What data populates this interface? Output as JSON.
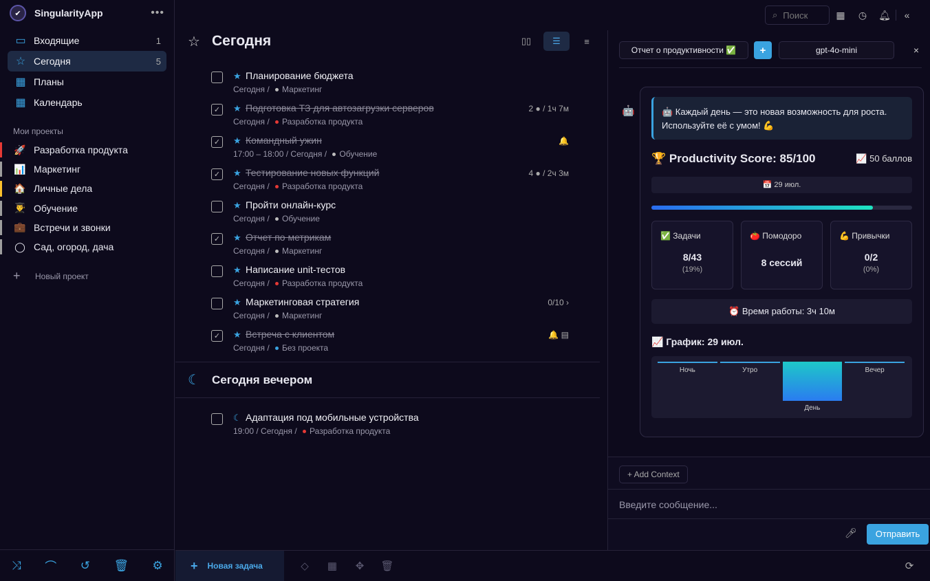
{
  "app": {
    "name": "SingularityApp"
  },
  "nav": [
    {
      "label": "Входящие",
      "count": "1",
      "icon": "inbox-icon",
      "glyph": "▭"
    },
    {
      "label": "Сегодня",
      "count": "5",
      "icon": "star-icon",
      "glyph": "☆"
    },
    {
      "label": "Планы",
      "count": "",
      "icon": "calendar-29-icon",
      "glyph": "▦"
    },
    {
      "label": "Календарь",
      "count": "",
      "icon": "calendar-icon",
      "glyph": "▦"
    }
  ],
  "projects_title": "Мои проекты",
  "projects": [
    {
      "label": "Разработка продукта",
      "glyph": "🚀",
      "color": "#e53935"
    },
    {
      "label": "Маркетинг",
      "glyph": "📊",
      "color": "#9e9e9e"
    },
    {
      "label": "Личные дела",
      "glyph": "🏠",
      "color": "#fbc02d"
    },
    {
      "label": "Обучение",
      "glyph": "👨‍🎓",
      "color": "#9e9e9e"
    },
    {
      "label": "Встречи и звонки",
      "glyph": "💼",
      "color": "#9e9e9e"
    },
    {
      "label": "Сад, огород, дача",
      "glyph": "◯",
      "color": "#9e9e9e"
    }
  ],
  "new_project": "Новый проект",
  "search_placeholder": "Поиск",
  "main_title": "Сегодня",
  "tasks": [
    {
      "title": "Планирование бюджета",
      "done": false,
      "meta": "Сегодня",
      "project": "Маркетинг",
      "dot": "#bdbdbd",
      "right": ""
    },
    {
      "title": "Подготовка ТЗ для автозагрузки серверов",
      "done": true,
      "meta": "Сегодня",
      "project": "Разработка продукта",
      "dot": "#e53935",
      "right": "2 ● / 1ч 7м"
    },
    {
      "title": "Командный ужин",
      "done": true,
      "meta": "17:00 – 18:00 / Сегодня",
      "project": "Обучение",
      "dot": "#bdbdbd",
      "right": "🔔"
    },
    {
      "title": "Тестирование новых функций",
      "done": true,
      "meta": "Сегодня",
      "project": "Разработка продукта",
      "dot": "#e53935",
      "right": "4 ● / 2ч 3м"
    },
    {
      "title": "Пройти онлайн-курс",
      "done": false,
      "meta": "Сегодня",
      "project": "Обучение",
      "dot": "#bdbdbd",
      "right": ""
    },
    {
      "title": "Отчет по метрикам",
      "done": true,
      "meta": "Сегодня",
      "project": "Маркетинг",
      "dot": "#bdbdbd",
      "right": ""
    },
    {
      "title": "Написание unit-тестов",
      "done": false,
      "meta": "Сегодня",
      "project": "Разработка продукта",
      "dot": "#e53935",
      "right": ""
    },
    {
      "title": "Маркетинговая стратегия",
      "done": false,
      "meta": "Сегодня",
      "project": "Маркетинг",
      "dot": "#bdbdbd",
      "right": "0/10   ›"
    },
    {
      "title": "Встреча с клиентом",
      "done": true,
      "meta": "Сегодня",
      "project": "Без проекта",
      "dot": "#3aa3e0",
      "right": "🔔  ▤"
    }
  ],
  "evening_title": "Сегодня вечером",
  "evening_task": {
    "title": "Адаптация под мобильные устройства",
    "meta": "19:00 / Сегодня",
    "project": "Разработка продукта"
  },
  "new_task": "Новая задача",
  "panel": {
    "report_btn": "Отчет о продуктивности ✅",
    "plus": "+",
    "model": "gpt-4o-mini",
    "close": "×",
    "quote": "🤖 Каждый день — это новая возможность для роста. Используйте её с умом! 💪",
    "score_title": "🏆 Productivity Score: 85/100",
    "score_points": "📈 50 баллов",
    "date": "📅 29 июл.",
    "progress": 0.85,
    "stats": [
      {
        "label": "✅ Задачи",
        "value": "8/43",
        "sub": "(19%)"
      },
      {
        "label": "🍅 Помодоро",
        "value": "8 сессий",
        "sub": ""
      },
      {
        "label": "💪 Привычки",
        "value": "0/2",
        "sub": "(0%)"
      }
    ],
    "work_time": "⏰ Время работы: 3ч 10м",
    "graph_title": "📈 График: 29 июл.",
    "graph": [
      {
        "label": "Ночь",
        "value": 0
      },
      {
        "label": "Утро",
        "value": 0
      },
      {
        "label": "День",
        "value": 1
      },
      {
        "label": "Вечер",
        "value": 0
      }
    ],
    "add_context": "+ Add Context",
    "message_placeholder": "Введите сообщение...",
    "send": "Отправить"
  }
}
